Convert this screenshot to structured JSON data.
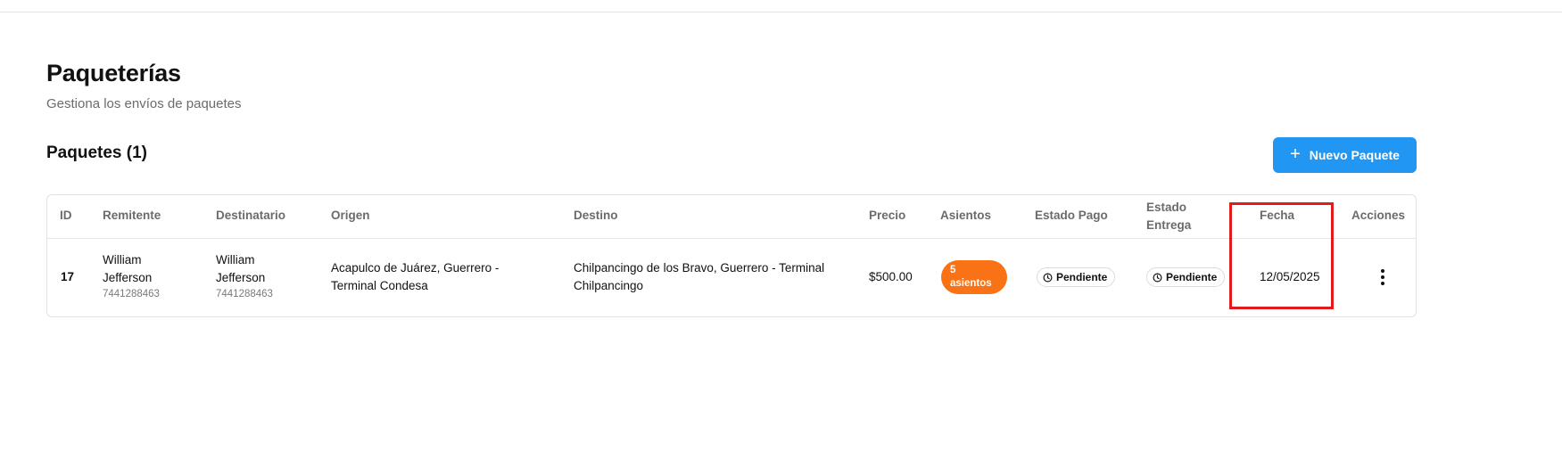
{
  "page": {
    "title": "Paqueterías",
    "subtitle": "Gestiona los envíos de paquetes"
  },
  "section": {
    "title": "Paquetes (1)",
    "new_button_label": "Nuevo Paquete",
    "new_button_icon": "plus-icon"
  },
  "colors": {
    "primary": "#2196f3",
    "seat_badge": "#f97316",
    "highlight": "#e01b1b"
  },
  "table": {
    "columns": [
      "ID",
      "Remitente",
      "Destinatario",
      "Origen",
      "Destino",
      "Precio",
      "Asientos",
      "Estado Pago",
      "Estado Entrega",
      "Fecha",
      "Acciones"
    ],
    "columns_wrapped": {
      "estado_entrega_line1": "Estado",
      "estado_entrega_line2": "Entrega"
    },
    "rows": [
      {
        "id": "17",
        "remitente_line1": "William",
        "remitente_line2": "Jefferson",
        "remitente_phone": "7441288463",
        "destinatario_line1": "William",
        "destinatario_line2": "Jefferson",
        "destinatario_phone": "7441288463",
        "origen_line1": "Acapulco de Juárez, Guerrero -",
        "origen_line2": "Terminal Condesa",
        "destino_line1": "Chilpancingo de los Bravo, Guerrero - Terminal",
        "destino_line2": "Chilpancingo",
        "precio": "$500.00",
        "asientos_line1": "5",
        "asientos_line2": "asientos",
        "estado_pago": "Pendiente",
        "estado_entrega": "Pendiente",
        "fecha": "12/05/2025",
        "acciones_icon": "more-vertical-icon"
      }
    ]
  }
}
